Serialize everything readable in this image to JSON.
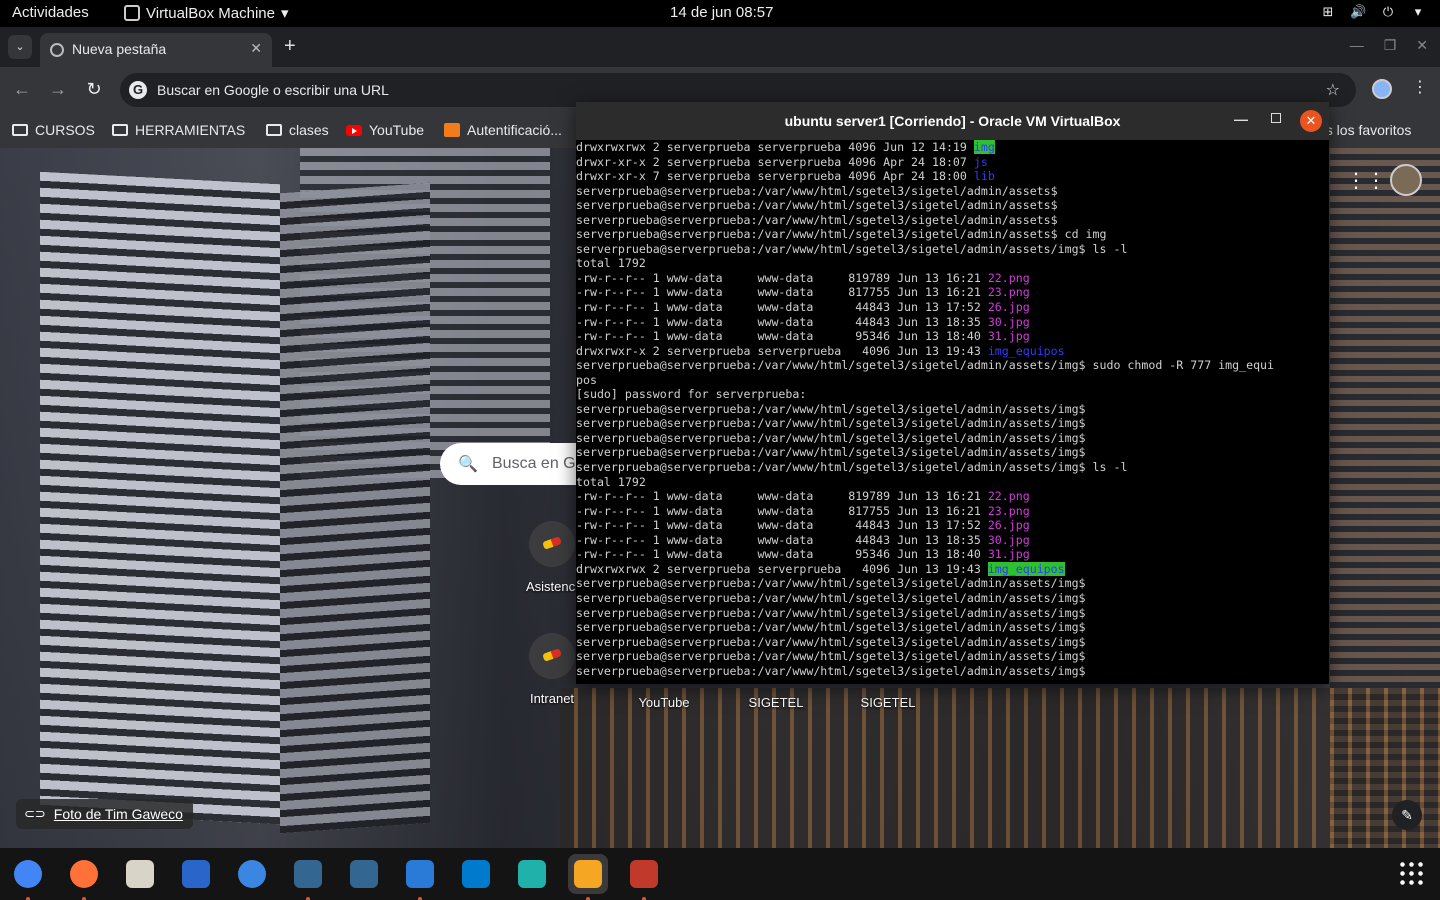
{
  "topbar": {
    "activities": "Actividades",
    "app_name": "VirtualBox Machine",
    "app_menu_icon": "chevron-down-icon",
    "clock": "14 de jun  08:57",
    "tray_icons": [
      "network-icon",
      "volume-icon",
      "power-icon",
      "chevron-down-icon"
    ]
  },
  "chrome": {
    "tab": {
      "title": "Nueva pestaña",
      "close": "✕"
    },
    "newtab": "+",
    "omnibox_placeholder": "Buscar en Google o escribir una URL",
    "bookmarks": [
      {
        "label": "CURSOS",
        "icon": "folder-icon"
      },
      {
        "label": "HERRAMIENTAS",
        "icon": "folder-icon"
      },
      {
        "label": "clases",
        "icon": "folder-icon"
      },
      {
        "label": "YouTube",
        "icon": "youtube-icon"
      },
      {
        "label": "Autentificació...",
        "icon": "auth-icon"
      }
    ],
    "bookmarks_overflow": "os los favoritos"
  },
  "ntp": {
    "search_placeholder": "Busca en G",
    "shortcuts": [
      {
        "label": "Asistenci"
      },
      {
        "label": "Intranet"
      },
      {
        "label": "YouTube"
      },
      {
        "label": "SIGETEL"
      },
      {
        "label": "SIGETEL"
      }
    ],
    "photo_credit": "Foto de Tim Gaweco"
  },
  "vbox": {
    "title": "ubuntu server1 [Corriendo] - Oracle VM VirtualBox",
    "terminal": [
      {
        "t": "drwxrwxrwx 2 serverprueba serverprueba 4096 Jun 12 14:19 ",
        "n": "img",
        "c": "hl"
      },
      {
        "t": "drwxr-xr-x 2 serverprueba serverprueba 4096 Apr 24 18:07 ",
        "n": "js",
        "c": "blue"
      },
      {
        "t": "drwxr-xr-x 7 serverprueba serverprueba 4096 Apr 24 18:00 ",
        "n": "lib",
        "c": "blue"
      },
      {
        "t": "serverprueba@serverprueba:/var/www/html/sgetel3/sigetel/admin/assets$"
      },
      {
        "t": "serverprueba@serverprueba:/var/www/html/sgetel3/sigetel/admin/assets$"
      },
      {
        "t": "serverprueba@serverprueba:/var/www/html/sgetel3/sigetel/admin/assets$"
      },
      {
        "t": "serverprueba@serverprueba:/var/www/html/sgetel3/sigetel/admin/assets$ cd img"
      },
      {
        "t": "serverprueba@serverprueba:/var/www/html/sgetel3/sigetel/admin/assets/img$ ls -l"
      },
      {
        "t": "total 1792"
      },
      {
        "t": "-rw-r--r-- 1 www-data     www-data     819789 Jun 13 16:21 ",
        "n": "22.png",
        "c": "mag"
      },
      {
        "t": "-rw-r--r-- 1 www-data     www-data     817755 Jun 13 16:21 ",
        "n": "23.png",
        "c": "mag"
      },
      {
        "t": "-rw-r--r-- 1 www-data     www-data      44843 Jun 13 17:52 ",
        "n": "26.jpg",
        "c": "mag"
      },
      {
        "t": "-rw-r--r-- 1 www-data     www-data      44843 Jun 13 18:35 ",
        "n": "30.jpg",
        "c": "mag"
      },
      {
        "t": "-rw-r--r-- 1 www-data     www-data      95346 Jun 13 18:40 ",
        "n": "31.jpg",
        "c": "mag"
      },
      {
        "t": "drwxrwxr-x 2 serverprueba serverprueba   4096 Jun 13 19:43 ",
        "n": "img_equipos",
        "c": "blue"
      },
      {
        "t": "serverprueba@serverprueba:/var/www/html/sgetel3/sigetel/admin/assets/img$ sudo chmod -R 777 img_equi"
      },
      {
        "t": "pos"
      },
      {
        "t": "[sudo] password for serverprueba:"
      },
      {
        "t": "serverprueba@serverprueba:/var/www/html/sgetel3/sigetel/admin/assets/img$"
      },
      {
        "t": "serverprueba@serverprueba:/var/www/html/sgetel3/sigetel/admin/assets/img$"
      },
      {
        "t": "serverprueba@serverprueba:/var/www/html/sgetel3/sigetel/admin/assets/img$"
      },
      {
        "t": "serverprueba@serverprueba:/var/www/html/sgetel3/sigetel/admin/assets/img$"
      },
      {
        "t": "serverprueba@serverprueba:/var/www/html/sgetel3/sigetel/admin/assets/img$ ls -l"
      },
      {
        "t": "total 1792"
      },
      {
        "t": "-rw-r--r-- 1 www-data     www-data     819789 Jun 13 16:21 ",
        "n": "22.png",
        "c": "mag"
      },
      {
        "t": "-rw-r--r-- 1 www-data     www-data     817755 Jun 13 16:21 ",
        "n": "23.png",
        "c": "mag"
      },
      {
        "t": "-rw-r--r-- 1 www-data     www-data      44843 Jun 13 17:52 ",
        "n": "26.jpg",
        "c": "mag"
      },
      {
        "t": "-rw-r--r-- 1 www-data     www-data      44843 Jun 13 18:35 ",
        "n": "30.jpg",
        "c": "mag"
      },
      {
        "t": "-rw-r--r-- 1 www-data     www-data      95346 Jun 13 18:40 ",
        "n": "31.jpg",
        "c": "mag"
      },
      {
        "t": "drwxrwxrwx 2 serverprueba serverprueba   4096 Jun 13 19:43 ",
        "n": "img_equipos",
        "c": "hl"
      },
      {
        "t": "serverprueba@serverprueba:/var/www/html/sgetel3/sigetel/admin/assets/img$"
      },
      {
        "t": "serverprueba@serverprueba:/var/www/html/sgetel3/sigetel/admin/assets/img$"
      },
      {
        "t": "serverprueba@serverprueba:/var/www/html/sgetel3/sigetel/admin/assets/img$"
      },
      {
        "t": "serverprueba@serverprueba:/var/www/html/sgetel3/sigetel/admin/assets/img$"
      },
      {
        "t": "serverprueba@serverprueba:/var/www/html/sgetel3/sigetel/admin/assets/img$"
      },
      {
        "t": "serverprueba@serverprueba:/var/www/html/sgetel3/sigetel/admin/assets/img$"
      },
      {
        "t": "serverprueba@serverprueba:/var/www/html/sgetel3/sigetel/admin/assets/img$"
      }
    ],
    "colors": {
      "blue": "#2f3aff",
      "magenta": "#d23bdc",
      "highlight": "#2fc02f",
      "close": "#e95420"
    }
  },
  "dock": {
    "items": [
      {
        "name": "chrome-icon",
        "color": "#4285f4",
        "running": true
      },
      {
        "name": "firefox-icon",
        "color": "#ff7139",
        "running": true
      },
      {
        "name": "files-icon",
        "color": "#d8d4c8",
        "running": false
      },
      {
        "name": "text-editor-icon",
        "color": "#2a66c9",
        "running": false
      },
      {
        "name": "thunderbird-icon",
        "color": "#3a86e0",
        "running": false
      },
      {
        "name": "pgadmin-icon",
        "color": "#336791",
        "running": true
      },
      {
        "name": "pgadmin-icon",
        "color": "#336791",
        "running": false
      },
      {
        "name": "system-monitor-icon",
        "color": "#2a7bd8",
        "running": true
      },
      {
        "name": "vscode-icon",
        "color": "#007acc",
        "running": false
      },
      {
        "name": "xampp-icon",
        "color": "#20b2aa",
        "running": false
      },
      {
        "name": "virtualbox-icon",
        "color": "#f5a623",
        "running": true
      },
      {
        "name": "terminal-app-icon",
        "color": "#c0392b",
        "running": true
      }
    ],
    "app_grid_icon": "grid-icon"
  }
}
